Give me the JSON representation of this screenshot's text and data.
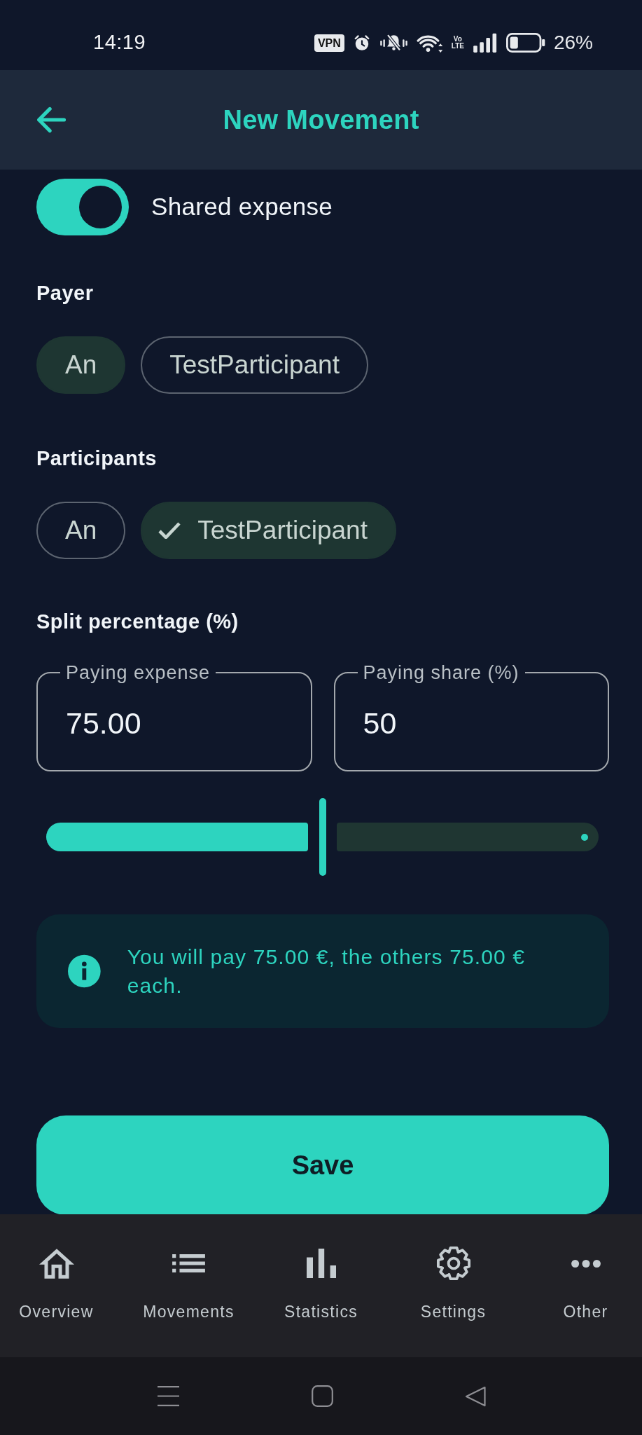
{
  "status_bar": {
    "time": "14:19",
    "vpn": "VPN",
    "network_type": [
      "Vo",
      "LTE"
    ],
    "battery": "26%"
  },
  "app_bar": {
    "title": "New Movement"
  },
  "shared_expense": {
    "label": "Shared expense",
    "on": true
  },
  "payer": {
    "label": "Payer",
    "options": [
      {
        "label": "An",
        "selected": true
      },
      {
        "label": "TestParticipant",
        "selected": false
      }
    ]
  },
  "participants": {
    "label": "Participants",
    "options": [
      {
        "label": "An",
        "selected": false
      },
      {
        "label": "TestParticipant",
        "selected": true
      }
    ]
  },
  "split": {
    "label": "Split percentage (%)",
    "fields": [
      {
        "label": "Paying expense",
        "value": "75.00"
      },
      {
        "label": "Paying share (%)",
        "value": "50"
      }
    ],
    "slider": {
      "level": 0.5
    }
  },
  "info": {
    "text": "You will pay 75.00 €, the others 75.00 € each."
  },
  "save_button": {
    "label": "Save"
  },
  "bottom_nav": [
    {
      "label": "Overview",
      "selected": false
    },
    {
      "label": "Movements",
      "selected": false
    },
    {
      "label": "Statistics",
      "selected": false
    },
    {
      "label": "Settings",
      "selected": false
    },
    {
      "label": "Other",
      "selected": false
    }
  ]
}
